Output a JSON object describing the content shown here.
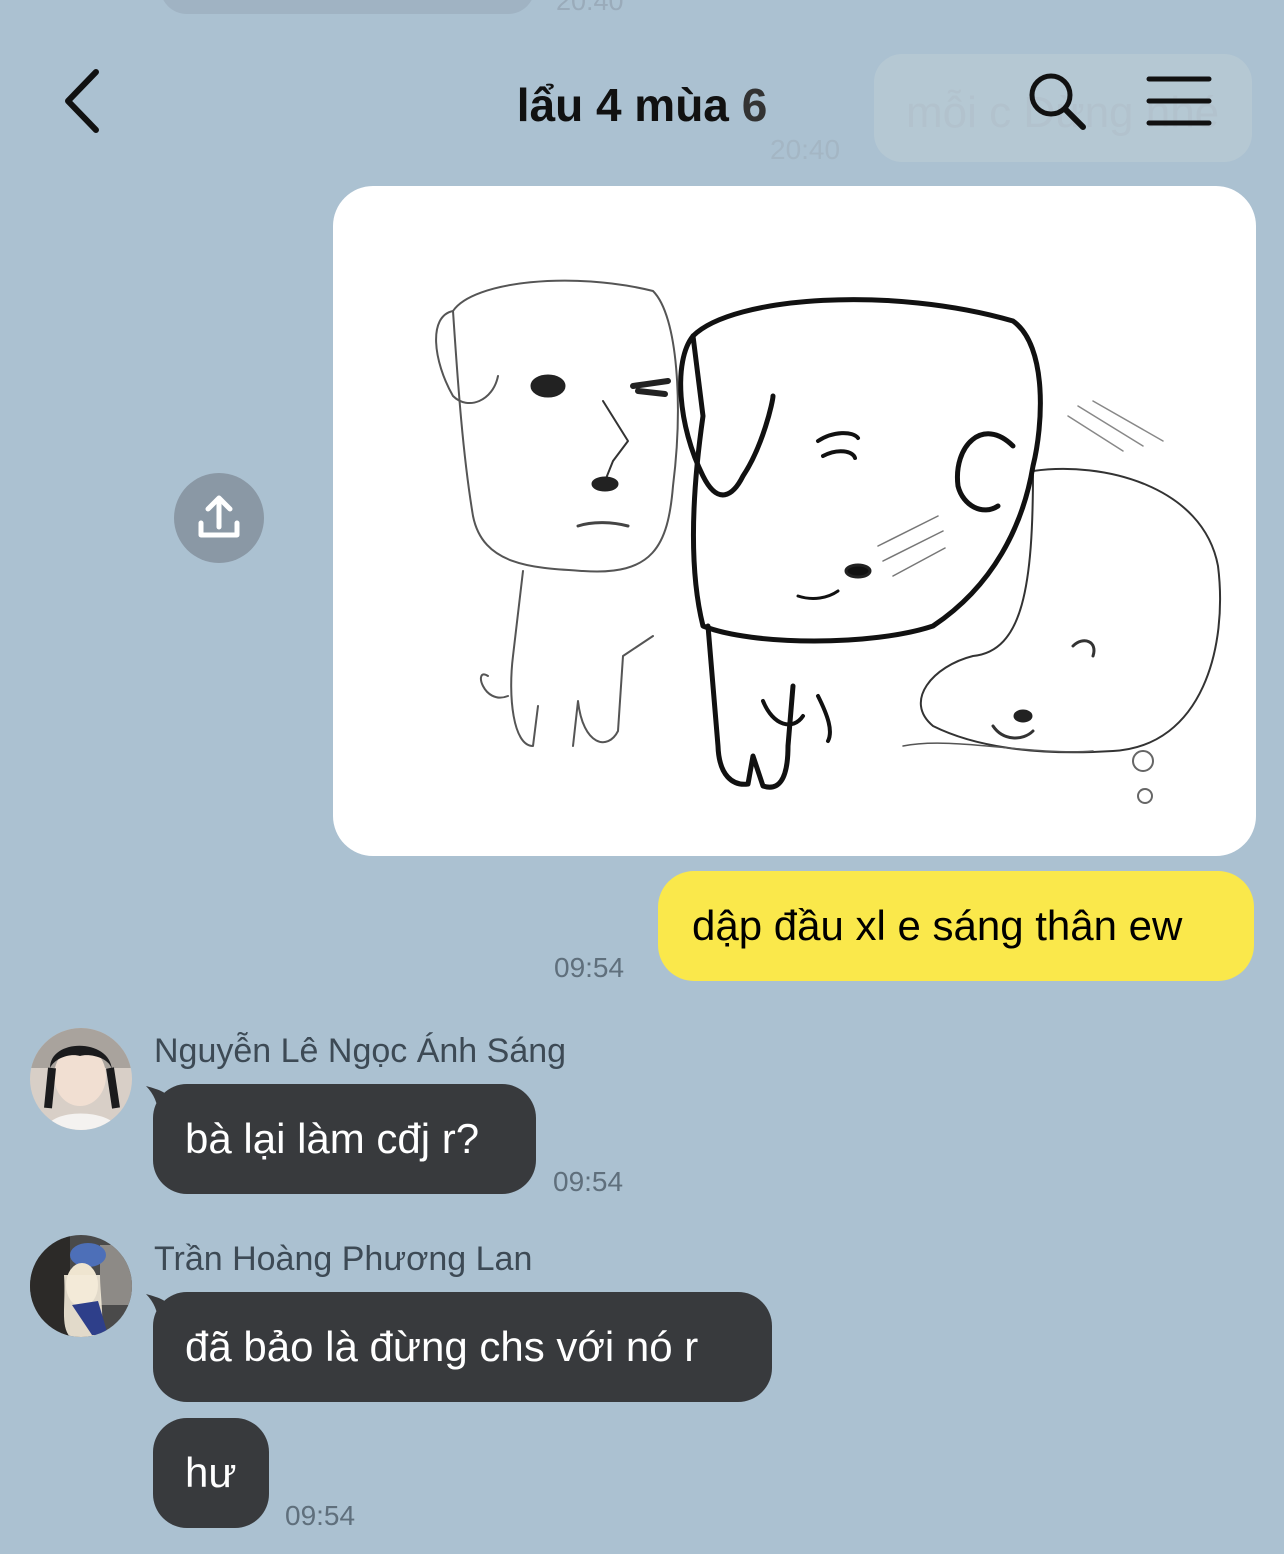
{
  "previous": {
    "top_time": "20:40",
    "ghost_text": "mỗi c Dừng nhé",
    "ghost_time": "20:40"
  },
  "header": {
    "title": "lẩu 4 mùa",
    "member_count": "6"
  },
  "icons": {
    "back": "chevron-left-icon",
    "search": "search-icon",
    "menu": "hamburger-menu-icon",
    "share": "share-upload-icon"
  },
  "colors": {
    "background": "#abc1d1",
    "outgoing_bubble": "#fae84b",
    "incoming_bubble": "#383a3d"
  },
  "messages": [
    {
      "type": "image",
      "direction": "out",
      "content": "sketch-of-three-dogs"
    },
    {
      "type": "text",
      "direction": "out",
      "text": "dập đầu xl e sáng thân ew",
      "time": "09:54"
    },
    {
      "type": "text",
      "direction": "in",
      "sender": "Nguyễn Lê Ngọc Ánh Sáng",
      "text": "bà lại làm cđj r?",
      "time": "09:54"
    },
    {
      "type": "text",
      "direction": "in",
      "sender": "Trần Hoàng Phương Lan",
      "text": "đã bảo là đừng chs với nó r"
    },
    {
      "type": "text",
      "direction": "in",
      "sender": "Trần Hoàng Phương Lan",
      "text": "hư",
      "time": "09:54"
    }
  ]
}
